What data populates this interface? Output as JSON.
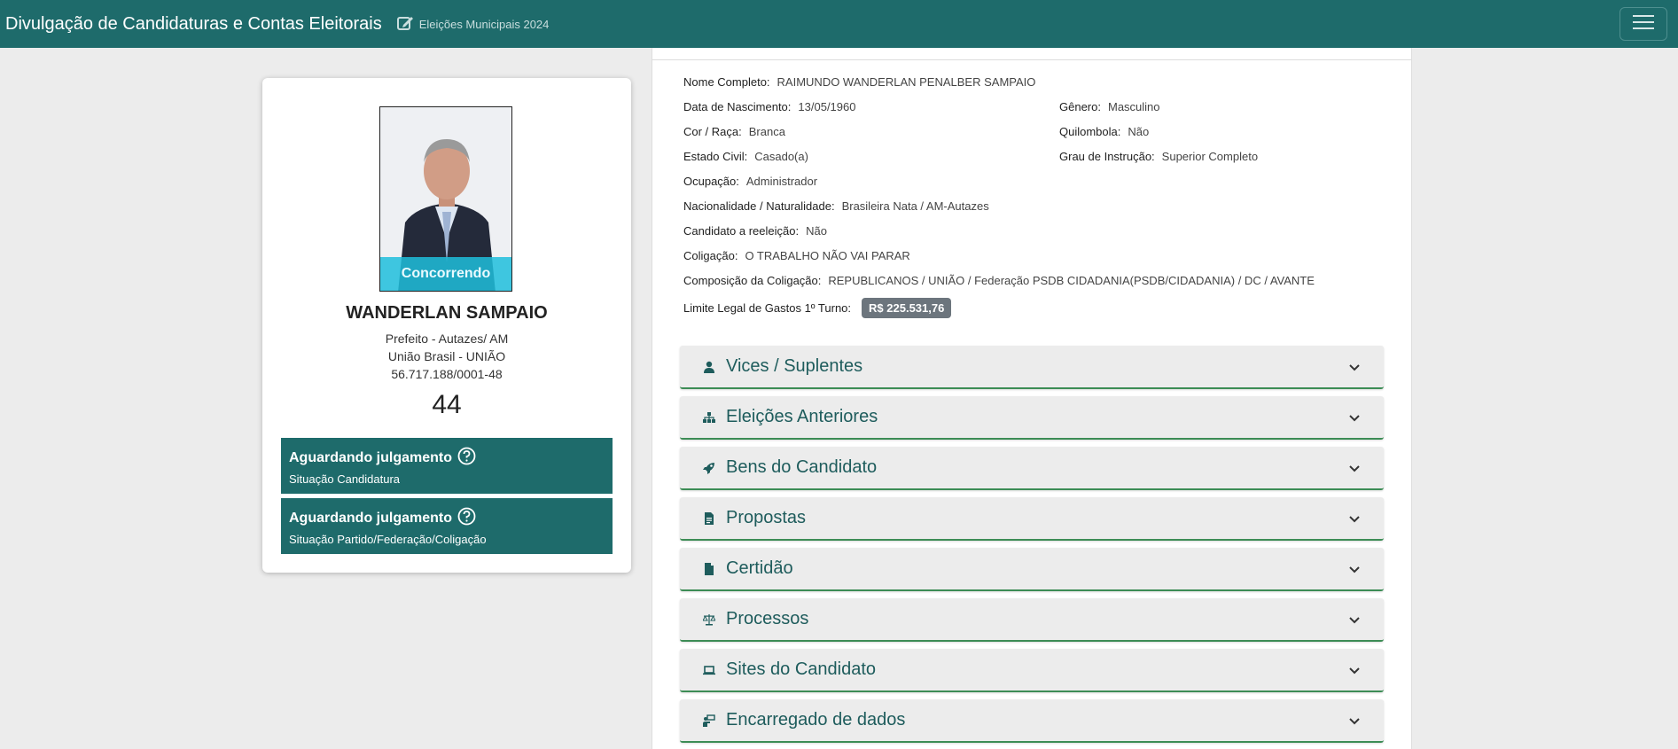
{
  "header": {
    "title": "Divulgação de Candidaturas e Contas Eleitorais",
    "subtitle": "Eleições Municipais 2024",
    "icons": {
      "subtitle": "edit-icon",
      "menu": "hamburger-icon"
    }
  },
  "candidate": {
    "photo_badge": "Concorrendo",
    "name": "WANDERLAN SAMPAIO",
    "office": "Prefeito - Autazes/ AM",
    "party": "União Brasil - UNIÃO",
    "cnpj": "56.717.188/0001-48",
    "number": "44",
    "statuses": [
      {
        "title": "Aguardando julgamento",
        "subtitle": "Situação Candidatura",
        "icon": "question-circle-icon"
      },
      {
        "title": "Aguardando julgamento",
        "subtitle": "Situação Partido/Federação/Coligação",
        "icon": "question-circle-icon"
      }
    ]
  },
  "details": {
    "nome_completo": {
      "label": "Nome Completo:",
      "value": "RAIMUNDO WANDERLAN PENALBER SAMPAIO"
    },
    "data_nascimento": {
      "label": "Data de Nascimento:",
      "value": "13/05/1960"
    },
    "genero": {
      "label": "Gênero:",
      "value": "Masculino"
    },
    "cor_raca": {
      "label": "Cor / Raça:",
      "value": "Branca"
    },
    "quilombola": {
      "label": "Quilombola:",
      "value": "Não"
    },
    "estado_civil": {
      "label": "Estado Civil:",
      "value": "Casado(a)"
    },
    "grau_instrucao": {
      "label": "Grau de Instrução:",
      "value": "Superior Completo"
    },
    "ocupacao": {
      "label": "Ocupação:",
      "value": "Administrador"
    },
    "nacionalidade": {
      "label": "Nacionalidade / Naturalidade:",
      "value": "Brasileira Nata / AM-Autazes"
    },
    "reeleicao": {
      "label": "Candidato a reeleição:",
      "value": "Não"
    },
    "coligacao": {
      "label": "Coligação:",
      "value": "O TRABALHO NÃO VAI PARAR"
    },
    "composicao": {
      "label": "Composição da Coligação:",
      "value": "REPUBLICANOS / UNIÃO / Federação PSDB CIDADANIA(PSDB/CIDADANIA) / DC / AVANTE"
    },
    "limite_gastos": {
      "label": "Limite Legal de Gastos 1º Turno:",
      "value": "R$ 225.531,76"
    }
  },
  "accordion": [
    {
      "label": "Vices / Suplentes",
      "icon": "person-icon"
    },
    {
      "label": "Eleições Anteriores",
      "icon": "sitemap-icon"
    },
    {
      "label": "Bens do Candidato",
      "icon": "rocket-icon"
    },
    {
      "label": "Propostas",
      "icon": "file-text-icon"
    },
    {
      "label": "Certidão",
      "icon": "file-icon"
    },
    {
      "label": "Processos",
      "icon": "scale-icon"
    },
    {
      "label": "Sites do Candidato",
      "icon": "laptop-icon"
    },
    {
      "label": "Encarregado de dados",
      "icon": "user-tie-icon"
    }
  ],
  "colors": {
    "primary": "#1e6b6b",
    "accent_border": "#3c8c55",
    "photo_badge": "#1ebedc",
    "badge_gray": "#6c757d"
  }
}
